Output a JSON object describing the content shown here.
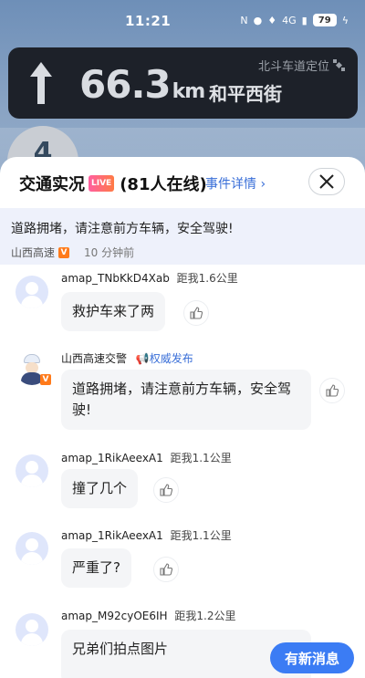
{
  "status_bar": {
    "time": "11:21",
    "network": "4G",
    "battery": "79"
  },
  "nav": {
    "distance": "66.3",
    "unit": "km",
    "street": "和平西街",
    "beidou": "北斗车道定位",
    "lane": "4"
  },
  "panel": {
    "title": "交通实况",
    "live_badge": "LIVE",
    "online": "(81人在线)",
    "event_link": "事件详情",
    "notice_text": "道路拥堵，请注意前方车辆，安全驾驶!",
    "notice_source": "山西高速",
    "notice_time": "10 分钟前"
  },
  "messages": [
    {
      "user": "amap_TNbKkD4Xab",
      "distance": "距我1.6公里",
      "text": "救护车来了两"
    },
    {
      "user": "山西高速交警",
      "auth": "权威发布",
      "text": "道路拥堵，请注意前方车辆，安全驾驶!"
    },
    {
      "user": "amap_1RikAeexA1",
      "distance": "距我1.1公里",
      "text": "撞了几个"
    },
    {
      "user": "amap_1RikAeexA1",
      "distance": "距我1.1公里",
      "text": "严重了?"
    },
    {
      "user": "amap_M92cyOE6IH",
      "distance": "距我1.2公里",
      "text": "兄弟们拍点图片"
    }
  ],
  "new_message_button": "有新消息",
  "colors": {
    "accent": "#3b7cf4",
    "nav_bg": "#1d2129",
    "notice_bg": "#eef1fb"
  }
}
